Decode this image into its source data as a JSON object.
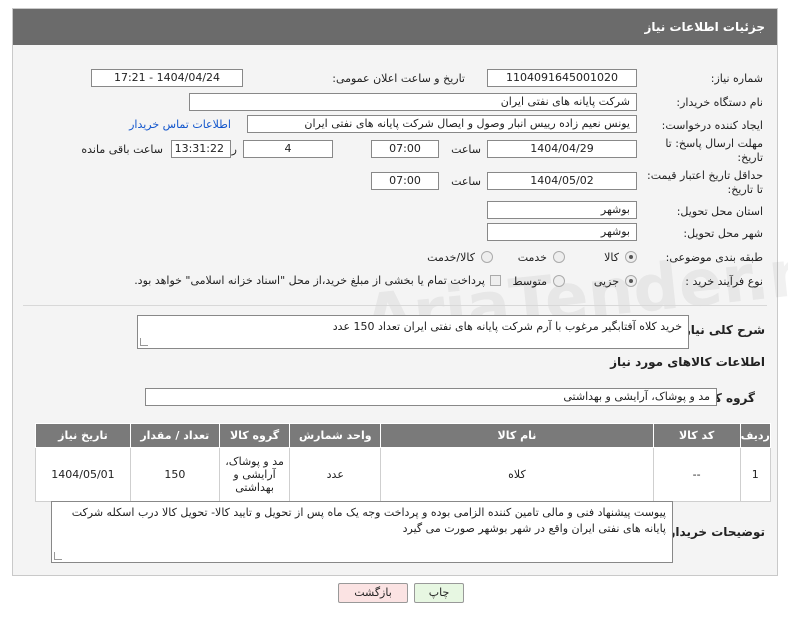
{
  "header": {
    "title": "جزئیات اطلاعات نیاز"
  },
  "fields": {
    "need_number_label": "شماره نیاز:",
    "need_number": "1104091645001020",
    "announce_label": "تاریخ و ساعت اعلان عمومی:",
    "announce_value": "1404/04/24 - 17:21",
    "buyer_org_label": "نام دستگاه خریدار:",
    "buyer_org": "شرکت پایانه های نفتی ایران",
    "creator_label": "ایجاد کننده درخواست:",
    "creator": "یونس نعیم زاده رییس انبار وصول و ایصال شرکت پایانه های نفتی ایران",
    "contact_link": "اطلاعات تماس خریدار",
    "reply_deadline_label": "مهلت ارسال پاسخ: تا تاریخ:",
    "reply_date": "1404/04/29",
    "time_label": "ساعت",
    "reply_time": "07:00",
    "days_value": "4",
    "days_label": "روز و",
    "remaining_time": "13:31:22",
    "remaining_label": "ساعت باقی مانده",
    "price_deadline_label": "حداقل تاریخ اعتبار قیمت: تا تاریخ:",
    "price_date": "1404/05/02",
    "price_time": "07:00",
    "delivery_province_label": "استان محل تحویل:",
    "delivery_province": "بوشهر",
    "delivery_city_label": "شهر محل تحویل:",
    "delivery_city": "بوشهر",
    "category_label": "طبقه بندی موضوعی:",
    "category_options": [
      "کالا",
      "خدمت",
      "کالا/خدمت"
    ],
    "category_selected": "کالا",
    "process_label": "نوع فرآیند خرید :",
    "process_options": [
      "جزیی",
      "متوسط"
    ],
    "process_selected": "جزیی",
    "payment_note": "پرداخت تمام یا بخشی از مبلغ خرید،از محل \"اسناد خزانه اسلامی\" خواهد بود."
  },
  "summary": {
    "label": "شرح کلی نیاز:",
    "text": "خرید کلاه آفتابگیر مرغوب با آرم شرکت پایانه های نفتی ایران تعداد 150 عدد"
  },
  "goods_info": {
    "title": "اطلاعات کالاهای مورد نیاز",
    "group_label": "گروه کالا:",
    "group_value": "مد و پوشاک، آرایشی و بهداشتی"
  },
  "table": {
    "headers": [
      "ردیف",
      "کد کالا",
      "نام کالا",
      "واحد شمارش",
      "گروه کالا",
      "تعداد / مقدار",
      "تاریخ نیاز"
    ],
    "rows": [
      [
        "1",
        "--",
        "کلاه",
        "عدد",
        "مد و پوشاک، آرایشی و بهداشتی",
        "150",
        "1404/05/01"
      ]
    ]
  },
  "buyer_notes": {
    "label": "توضیحات خریدار:",
    "text": "پیوست پیشنهاد فنی و مالی تامین کننده الزامی بوده و پرداخت وجه یک ماه پس از تحویل و تایید کالا- تحویل کالا درب اسکله شرکت پایانه های نفتی ایران واقع در شهر بوشهر صورت می گیرد"
  },
  "buttons": {
    "print": "چاپ",
    "back": "بازگشت"
  },
  "watermark": "AriaTender.net",
  "colors": {
    "header_bg": "#6b6b6b",
    "table_header_bg": "#7a7a7a",
    "link": "#1155cc",
    "back_btn_bg": "#fbe3e3",
    "print_btn_bg": "#e7f7e2"
  }
}
